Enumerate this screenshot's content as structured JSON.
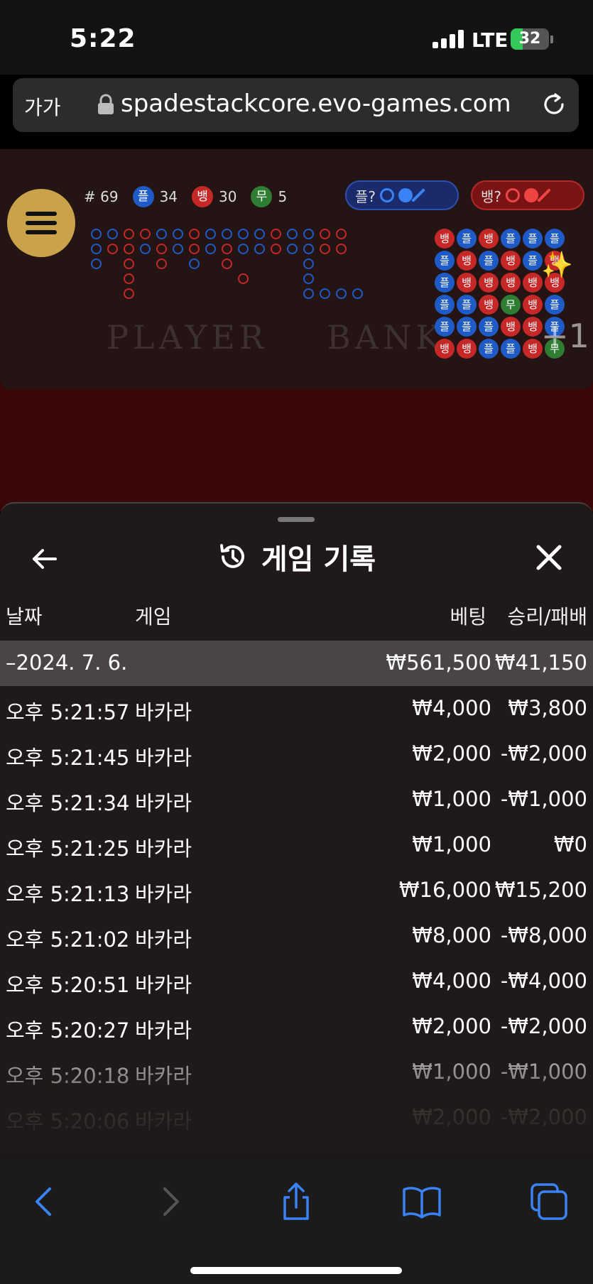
{
  "status_bar": {
    "time": "5:22",
    "network": "LTE",
    "battery": "32",
    "battery_level": 0.32
  },
  "browser": {
    "text_size_label": "가가",
    "url": "spadestackcore.evo-games.com"
  },
  "game": {
    "round_label": "# 69",
    "player": {
      "label": "플",
      "count": "34"
    },
    "banker": {
      "label": "뱅",
      "count": "30"
    },
    "tie": {
      "label": "무",
      "count": "5"
    },
    "player_predict": "플?",
    "banker_predict": "뱅?",
    "watermark_player": "PLAYER",
    "watermark_banker": "BANK",
    "plus_badge": "+1",
    "bead_rows": [
      [
        "뱅",
        "플",
        "뱅",
        "플",
        "플",
        "플"
      ],
      [
        "플",
        "뱅",
        "플",
        "뱅",
        "플",
        "뱅"
      ],
      [
        "플",
        "뱅",
        "뱅",
        "뱅",
        "뱅",
        "뱅"
      ],
      [
        "플",
        "플",
        "뱅",
        "무",
        "뱅",
        "플"
      ],
      [
        "플",
        "플",
        "플",
        "뱅",
        "뱅",
        "플"
      ],
      [
        "뱅",
        "뱅",
        "플",
        "플",
        "뱅",
        "무"
      ]
    ]
  },
  "sheet": {
    "title": "게임 기록",
    "columns": {
      "date": "날짜",
      "game": "게임",
      "bet": "베팅",
      "result": "승리/패배"
    },
    "group": {
      "date": "–2024. 7. 6.",
      "bet": "₩561,500",
      "result": "₩41,150"
    },
    "rows": [
      {
        "time": "오후 5:21:57",
        "game": "바카라",
        "bet": "₩4,000",
        "result": "₩3,800"
      },
      {
        "time": "오후 5:21:45",
        "game": "바카라",
        "bet": "₩2,000",
        "result": "-₩2,000"
      },
      {
        "time": "오후 5:21:34",
        "game": "바카라",
        "bet": "₩1,000",
        "result": "-₩1,000"
      },
      {
        "time": "오후 5:21:25",
        "game": "바카라",
        "bet": "₩1,000",
        "result": "₩0"
      },
      {
        "time": "오후 5:21:13",
        "game": "바카라",
        "bet": "₩16,000",
        "result": "₩15,200"
      },
      {
        "time": "오후 5:21:02",
        "game": "바카라",
        "bet": "₩8,000",
        "result": "-₩8,000"
      },
      {
        "time": "오후 5:20:51",
        "game": "바카라",
        "bet": "₩4,000",
        "result": "-₩4,000"
      },
      {
        "time": "오후 5:20:27",
        "game": "바카라",
        "bet": "₩2,000",
        "result": "-₩2,000"
      },
      {
        "time": "오후 5:20:18",
        "game": "바카라",
        "bet": "₩1,000",
        "result": "-₩1,000"
      },
      {
        "time": "오후 5:20:06",
        "game": "바카라",
        "bet": "₩2,000",
        "result": "-₩2,000"
      }
    ]
  },
  "colors": {
    "player": "#1e5bc6",
    "banker": "#c62828",
    "tie": "#2e7d32",
    "accent": "#c9a24a",
    "ios_blue": "#3b82f6"
  },
  "toolbar_icons": [
    "back-arrow-icon",
    "forward-arrow-icon",
    "share-icon",
    "bookmarks-icon",
    "tabs-icon"
  ]
}
